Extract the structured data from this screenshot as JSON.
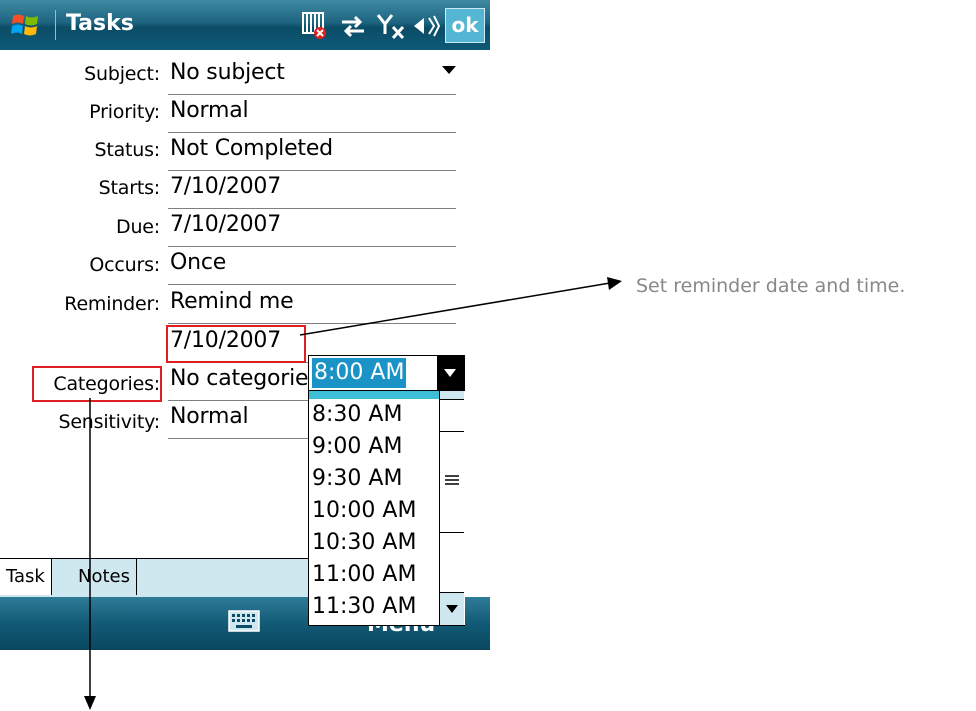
{
  "titlebar": {
    "app_title": "Tasks",
    "ok_label": "ok",
    "icons": [
      "windows-start-icon",
      "no-sim-icon",
      "connectivity-icon",
      "signal-off-icon",
      "volume-icon"
    ]
  },
  "form": {
    "rows": [
      {
        "label": "Subject:",
        "value": "No subject"
      },
      {
        "label": "Priority:",
        "value": "Normal"
      },
      {
        "label": "Status:",
        "value": "Not Completed"
      },
      {
        "label": "Starts:",
        "value": "7/10/2007"
      },
      {
        "label": "Due:",
        "value": "7/10/2007"
      },
      {
        "label": "Occurs:",
        "value": "Once"
      },
      {
        "label": "Reminder:",
        "value": "Remind me"
      },
      {
        "label": "",
        "value": "7/10/2007"
      },
      {
        "label": "Categories:",
        "value": "No categorie"
      },
      {
        "label": "Sensitivity:",
        "value": "Normal"
      }
    ]
  },
  "time_picker": {
    "selected": "8:00 AM",
    "options": [
      "8:00 AM",
      "8:30 AM",
      "9:00 AM",
      "9:30 AM",
      "10:00 AM",
      "10:30 AM",
      "11:00 AM",
      "11:30 AM"
    ]
  },
  "tabs": [
    "Task",
    "Notes"
  ],
  "softkeys": {
    "right": "Menu"
  },
  "callouts": {
    "reminder": "Set reminder date and time."
  },
  "colors": {
    "titlebar": "#1d6480",
    "selection": "#3dbfd8",
    "callout_box": "#e02020"
  }
}
